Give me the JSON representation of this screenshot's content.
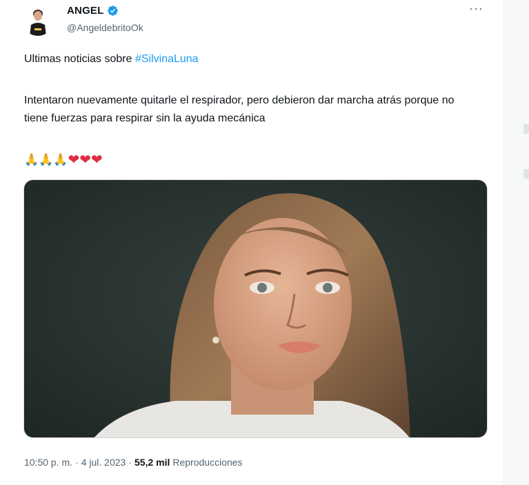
{
  "tweet": {
    "author_name": "ANGEL",
    "handle": "@AngeldebritoOk",
    "more_label": "···",
    "intro_text": "Ultimas noticias sobre ",
    "hashtag": "#SilvinaLuna",
    "body": "Intentaron nuevamente quitarle el respirador, pero debieron dar marcha atrás porque no tiene fuerzas para respirar sin la ayuda mecánica",
    "emojis": {
      "pray": "🙏",
      "heart": "❤"
    },
    "time": "10:50 p. m.",
    "separator": "·",
    "date": "4 jul. 2023",
    "views_count": "55,2 mil",
    "views_label": "Reproducciones"
  },
  "colors": {
    "accent": "#1d9bf0",
    "text_primary": "#0f1419",
    "text_secondary": "#536471",
    "heart": "#dd2e44"
  },
  "icons": {
    "verified": "verified-badge-icon",
    "more": "more-options-icon"
  }
}
